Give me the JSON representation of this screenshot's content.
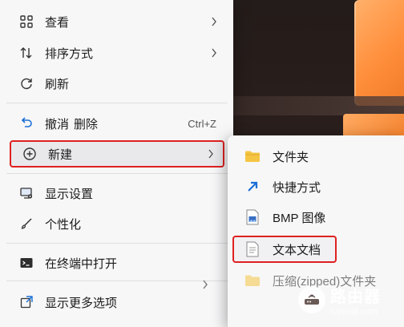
{
  "menu": {
    "items": [
      {
        "label": "查看",
        "icon": "grid-view-icon",
        "has_submenu": true
      },
      {
        "label": "排序方式",
        "icon": "sort-icon",
        "has_submenu": true
      },
      {
        "label": "刷新",
        "icon": "refresh-icon"
      },
      {
        "label": "撤消",
        "extra": "删除",
        "shortcut": "Ctrl+Z",
        "icon": "undo-icon"
      },
      {
        "label": "新建",
        "icon": "new-plus-icon",
        "has_submenu": true,
        "state": "active"
      },
      {
        "label": "显示设置",
        "icon": "display-settings-icon"
      },
      {
        "label": "个性化",
        "icon": "personalize-brush-icon"
      },
      {
        "label": "在终端中打开",
        "icon": "terminal-icon"
      },
      {
        "label": "显示更多选项",
        "icon": "more-options-icon"
      }
    ]
  },
  "submenu": {
    "items": [
      {
        "label": "文件夹",
        "icon": "folder-icon"
      },
      {
        "label": "快捷方式",
        "icon": "shortcut-arrow-icon"
      },
      {
        "label": "BMP 图像",
        "icon": "bmp-image-icon"
      },
      {
        "label": "文本文档",
        "icon": "text-document-icon",
        "state": "highlighted"
      },
      {
        "label": "压缩(zipped)文件夹",
        "icon": "zip-folder-icon"
      }
    ]
  },
  "watermark": {
    "title": "路由器",
    "url": "luyouqi.com"
  },
  "colors": {
    "highlight_outline": "#e02020",
    "accent_blue": "#1a6fd8",
    "folder_yellow": "#f5c542",
    "menu_bg": "#f7f7f8",
    "logo_orange": "#ff8f3c"
  }
}
